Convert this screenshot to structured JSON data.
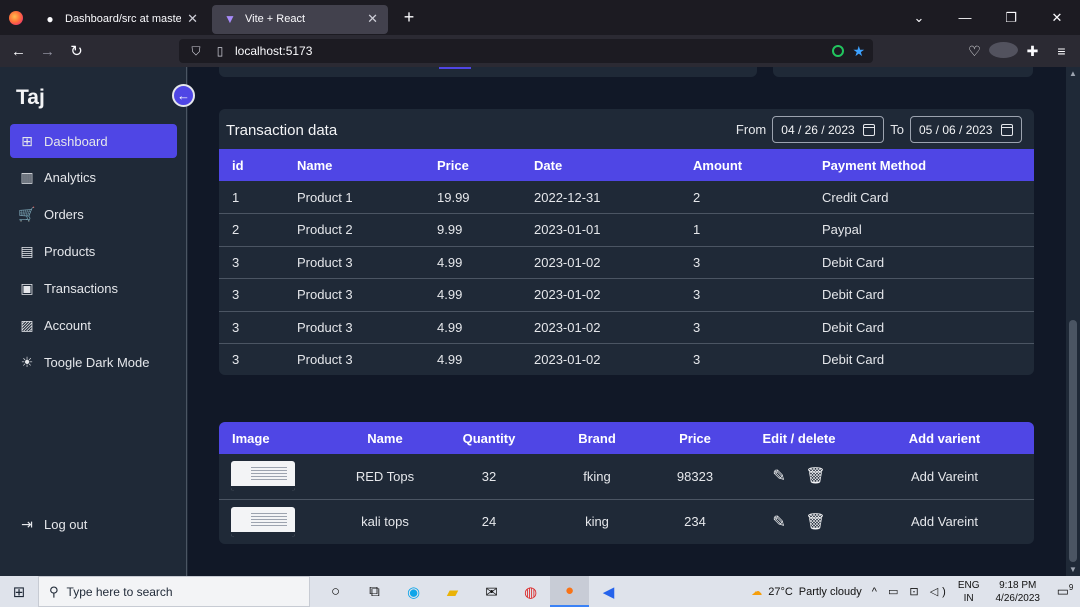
{
  "browser": {
    "tabs": [
      {
        "title": "Dashboard/src at master · Hayat",
        "active": false
      },
      {
        "title": "Vite + React",
        "active": true
      }
    ],
    "url": "localhost:5173"
  },
  "sidebar": {
    "brand": "Taj",
    "items": [
      {
        "label": "Dashboard",
        "icon": "dashboard-icon",
        "glyph": "⊞",
        "active": true
      },
      {
        "label": "Analytics",
        "icon": "analytics-icon",
        "glyph": "▥"
      },
      {
        "label": "Orders",
        "icon": "cart-icon",
        "glyph": "🛒"
      },
      {
        "label": "Products",
        "icon": "products-icon",
        "glyph": "▤"
      },
      {
        "label": "Transactions",
        "icon": "transactions-icon",
        "glyph": "▣"
      },
      {
        "label": "Account",
        "icon": "account-icon",
        "glyph": "▨"
      },
      {
        "label": "Toogle Dark Mode",
        "icon": "sun-icon",
        "glyph": "☀"
      }
    ],
    "logout": "Log out"
  },
  "transactions": {
    "title": "Transaction data",
    "from_label": "From",
    "to_label": "To",
    "from_date": "04 / 26 / 2023",
    "to_date": "05 / 06 / 2023",
    "columns": [
      "id",
      "Name",
      "Price",
      "Date",
      "Amount",
      "Payment Method"
    ],
    "rows": [
      [
        "1",
        "Product 1",
        "19.99",
        "2022-12-31",
        "2",
        "Credit Card"
      ],
      [
        "2",
        "Product 2",
        "9.99",
        "2023-01-01",
        "1",
        "Paypal"
      ],
      [
        "3",
        "Product 3",
        "4.99",
        "2023-01-02",
        "3",
        "Debit Card"
      ],
      [
        "3",
        "Product 3",
        "4.99",
        "2023-01-02",
        "3",
        "Debit Card"
      ],
      [
        "3",
        "Product 3",
        "4.99",
        "2023-01-02",
        "3",
        "Debit Card"
      ],
      [
        "3",
        "Product 3",
        "4.99",
        "2023-01-02",
        "3",
        "Debit Card"
      ]
    ]
  },
  "products": {
    "columns": [
      "Image",
      "Name",
      "Quantity",
      "Brand",
      "Price",
      "Edit / delete",
      "Add varient"
    ],
    "rows": [
      {
        "name": "RED Tops",
        "quantity": "32",
        "brand": "fking",
        "price": "98323",
        "add": "Add Vareint"
      },
      {
        "name": "kali tops",
        "quantity": "24",
        "brand": "king",
        "price": "234",
        "add": "Add Vareint"
      }
    ]
  },
  "taskbar": {
    "search_placeholder": "Type here to search",
    "temperature": "27°C",
    "weather": "Partly cloudy",
    "lang1": "ENG",
    "lang2": "IN",
    "time": "9:18 PM",
    "date": "4/26/2023",
    "notifications": "9"
  }
}
